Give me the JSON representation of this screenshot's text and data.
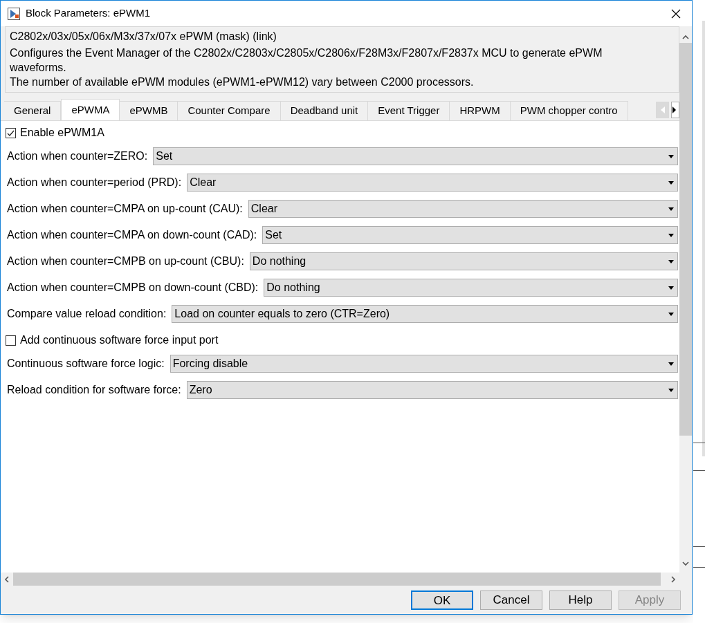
{
  "window": {
    "title": "Block Parameters: ePWM1"
  },
  "mask": {
    "title": "C2802x/03x/05x/06x/M3x/37x/07x ePWM (mask) (link)",
    "description": [
      "Configures the Event Manager of the C2802x/C2803x/C2805x/C2806x/F28M3x/F2807x/F2837x MCU to generate ePWM waveforms.",
      "The number of available ePWM modules (ePWM1-ePWM12) vary between C2000 processors."
    ]
  },
  "tabs": [
    {
      "label": "General",
      "selected": false
    },
    {
      "label": "ePWMA",
      "selected": true
    },
    {
      "label": "ePWMB",
      "selected": false
    },
    {
      "label": "Counter Compare",
      "selected": false
    },
    {
      "label": "Deadband unit",
      "selected": false
    },
    {
      "label": "Event Trigger",
      "selected": false
    },
    {
      "label": "HRPWM",
      "selected": false
    },
    {
      "label": "PWM chopper contro",
      "selected": false
    }
  ],
  "parameters": [
    {
      "kind": "checkbox",
      "label": "Enable ePWM1A",
      "checked": true
    },
    {
      "kind": "dropdown",
      "label": "Action when counter=ZERO:",
      "value": "Set"
    },
    {
      "kind": "dropdown",
      "label": "Action when counter=period (PRD):",
      "value": "Clear"
    },
    {
      "kind": "dropdown",
      "label": "Action when counter=CMPA on up-count (CAU):",
      "value": "Clear"
    },
    {
      "kind": "dropdown",
      "label": "Action when counter=CMPA on down-count (CAD):",
      "value": "Set"
    },
    {
      "kind": "dropdown",
      "label": "Action when counter=CMPB on up-count (CBU):",
      "value": "Do nothing"
    },
    {
      "kind": "dropdown",
      "label": "Action when counter=CMPB on down-count (CBD):",
      "value": "Do nothing"
    },
    {
      "kind": "dropdown",
      "label": "Compare value reload condition:",
      "value": "Load on counter equals to zero (CTR=Zero)"
    },
    {
      "kind": "checkbox",
      "label": "Add continuous software force input port",
      "checked": false
    },
    {
      "kind": "dropdown",
      "label": "Continuous software force logic:",
      "value": "Forcing disable"
    },
    {
      "kind": "dropdown",
      "label": "Reload condition for software force:",
      "value": "Zero"
    }
  ],
  "buttons": [
    {
      "label": "OK",
      "default": true,
      "disabled": false
    },
    {
      "label": "Cancel",
      "default": false,
      "disabled": false
    },
    {
      "label": "Help",
      "default": false,
      "disabled": false
    },
    {
      "label": "Apply",
      "default": false,
      "disabled": true
    }
  ]
}
